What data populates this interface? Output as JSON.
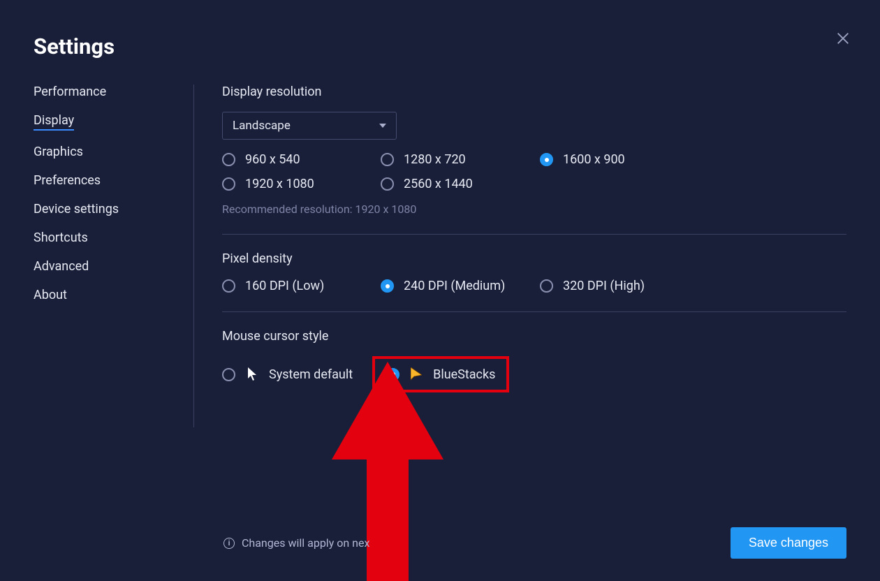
{
  "title": "Settings",
  "sidebar": {
    "items": [
      {
        "label": "Performance"
      },
      {
        "label": "Display"
      },
      {
        "label": "Graphics"
      },
      {
        "label": "Preferences"
      },
      {
        "label": "Device settings"
      },
      {
        "label": "Shortcuts"
      },
      {
        "label": "Advanced"
      },
      {
        "label": "About"
      }
    ],
    "active_index": 1
  },
  "display": {
    "resolution_title": "Display resolution",
    "orientation_selected": "Landscape",
    "resolutions": [
      "960 x 540",
      "1280 x 720",
      "1600 x 900",
      "1920 x 1080",
      "2560 x 1440"
    ],
    "resolution_selected_index": 2,
    "recommended": "Recommended resolution: 1920 x 1080"
  },
  "pixel_density": {
    "title": "Pixel density",
    "options": [
      "160 DPI (Low)",
      "240 DPI (Medium)",
      "320 DPI (High)"
    ],
    "selected_index": 1
  },
  "cursor": {
    "title": "Mouse cursor style",
    "options": [
      "System default",
      "BlueStacks"
    ],
    "selected_index": 1
  },
  "footer": {
    "note": "Changes will apply on nex",
    "save_label": "Save changes"
  },
  "annotation": {
    "highlight_target": "cursor.options.1",
    "arrow_color": "#e3000f"
  }
}
